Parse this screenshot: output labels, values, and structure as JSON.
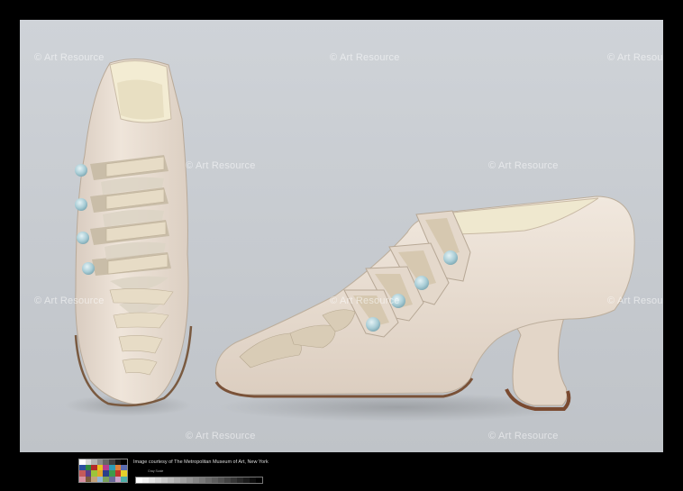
{
  "watermark": {
    "text": "© Art Resource"
  },
  "credit": {
    "line": "Image courtesy of The Metropolitan Museum of Art, New York",
    "scale_label": "Gray Scale"
  },
  "colors": {
    "background": "#c8ccd1",
    "frame": "#000000",
    "shoe_leather": "#e9ddd2",
    "button": "#9ec6cf",
    "beading": "#d8cbb4"
  },
  "swatch_colors": [
    "#ffffff",
    "#d9d9d9",
    "#b3b3b3",
    "#8c8c8c",
    "#666666",
    "#404040",
    "#1a1a1a",
    "#000000",
    "#2b4fa0",
    "#2f8a3c",
    "#b32a2a",
    "#e8c21e",
    "#b83d8e",
    "#2f9cb5",
    "#e0813a",
    "#5a6cb0",
    "#c45a5a",
    "#5a3c8a",
    "#9bc43a",
    "#e3a62a",
    "#2c3e8a",
    "#3c9a4a",
    "#c0352b",
    "#e5d02b",
    "#d88fa0",
    "#7a5a3a",
    "#c4a27a",
    "#8fb5d8",
    "#7aa05a",
    "#6a6a9a",
    "#c9a3c9",
    "#4fb0a8"
  ]
}
